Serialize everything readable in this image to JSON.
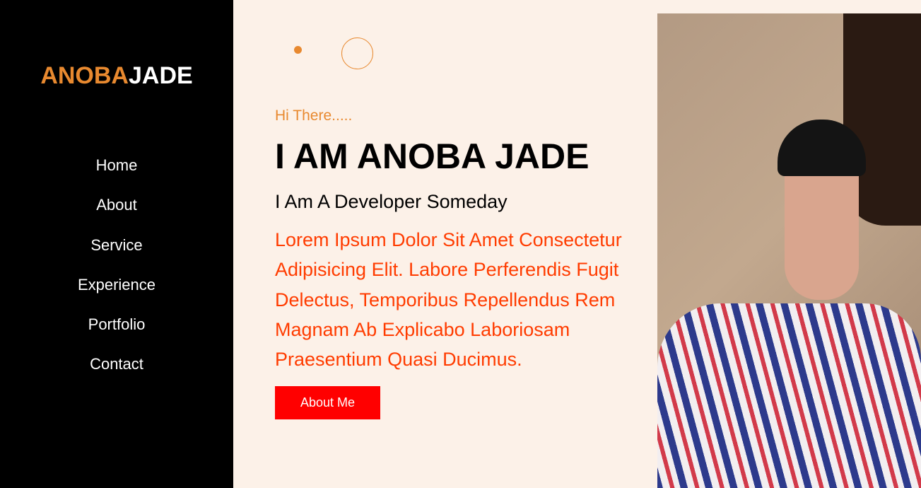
{
  "logo": {
    "part1": "ANOBA",
    "part2": "JADE"
  },
  "nav": [
    "Home",
    "About",
    "Service",
    "Experience",
    "Portfolio",
    "Contact"
  ],
  "hero": {
    "greeting": "Hi There.....",
    "title": "I AM ANOBA JADE",
    "subtitle": "I Am A Developer Someday",
    "description": "Lorem Ipsum Dolor Sit Amet Consectetur Adipisicing Elit. Labore Perferendis Fugit Delectus, Temporibus Repellendus Rem Magnam Ab Explicabo Laboriosam Praesentium Quasi Ducimus.",
    "button": "About Me"
  },
  "colors": {
    "accent": "#e8892f",
    "text_red": "#ff3c00",
    "button": "#ff0000",
    "bg": "#fcf1e8"
  }
}
